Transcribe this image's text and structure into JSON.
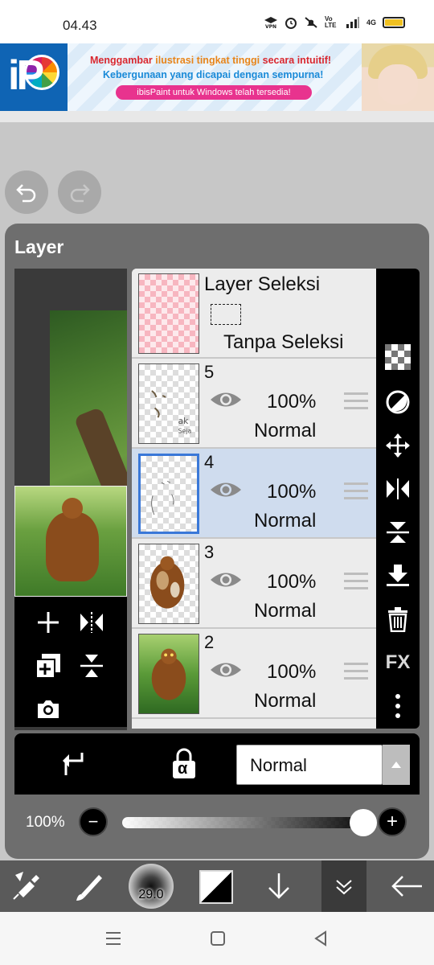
{
  "status_bar": {
    "time": "04.43",
    "icons": [
      "vpn-icon",
      "alarm-icon",
      "mute-icon",
      "volte-icon",
      "signal-icon",
      "4g-signal-icon",
      "battery-icon"
    ],
    "volte": "Vo LTE",
    "net": "4G"
  },
  "ad": {
    "line1_a": "Menggambar ",
    "line1_b": "ilustrasi tingkat tinggi",
    "line1_c": " secara intuitif!",
    "line2": "Kebergunaan yang dicapai dengan sempurna!",
    "pill": "ibisPaint untuk Windows telah tersedia!",
    "logo_text": "iP",
    "colors": {
      "logo_bg": "#0f64b4",
      "red": "#d9282f",
      "orange": "#e8851a",
      "blue": "#1a8ad8",
      "pink": "#e8338e"
    }
  },
  "panel": {
    "title": "Layer"
  },
  "layers": [
    {
      "type": "selection",
      "title": "Layer Seleksi",
      "subtitle": "Tanpa Seleksi"
    },
    {
      "number": "5",
      "opacity": "100%",
      "blend": "Normal",
      "selected": false,
      "visible": true
    },
    {
      "number": "4",
      "opacity": "100%",
      "blend": "Normal",
      "selected": true,
      "visible": true
    },
    {
      "number": "3",
      "opacity": "100%",
      "blend": "Normal",
      "selected": false,
      "visible": true
    },
    {
      "number": "2",
      "opacity": "100%",
      "blend": "Normal",
      "selected": false,
      "visible": true
    }
  ],
  "right_tools": [
    "checker-icon",
    "invert-icon",
    "move-icon",
    "flip-horizontal-icon",
    "flip-vertical-icon",
    "merge-down-icon",
    "trash-icon",
    "fx-icon",
    "more-icon"
  ],
  "fx_label": "FX",
  "left_tools": [
    "add-layer-icon",
    "flip-icon",
    "duplicate-layer-icon",
    "merge-icon",
    "camera-icon"
  ],
  "blend_bar": {
    "clip_icon": "clip-icon",
    "alpha_lock_label": "α",
    "blend_mode": "Normal"
  },
  "opacity_bar": {
    "label": "100%",
    "value": 1.0,
    "minus": "−",
    "plus": "+"
  },
  "bottom_toolbar": {
    "brush_size": "29.0",
    "items": [
      "transform-icon",
      "brush-icon",
      "brush-size",
      "color-swatch",
      "down-arrow-icon",
      "collapse-icon",
      "back-arrow-icon"
    ]
  },
  "nav_bar": {
    "items": [
      "menu-icon",
      "home-icon",
      "back-icon"
    ]
  }
}
